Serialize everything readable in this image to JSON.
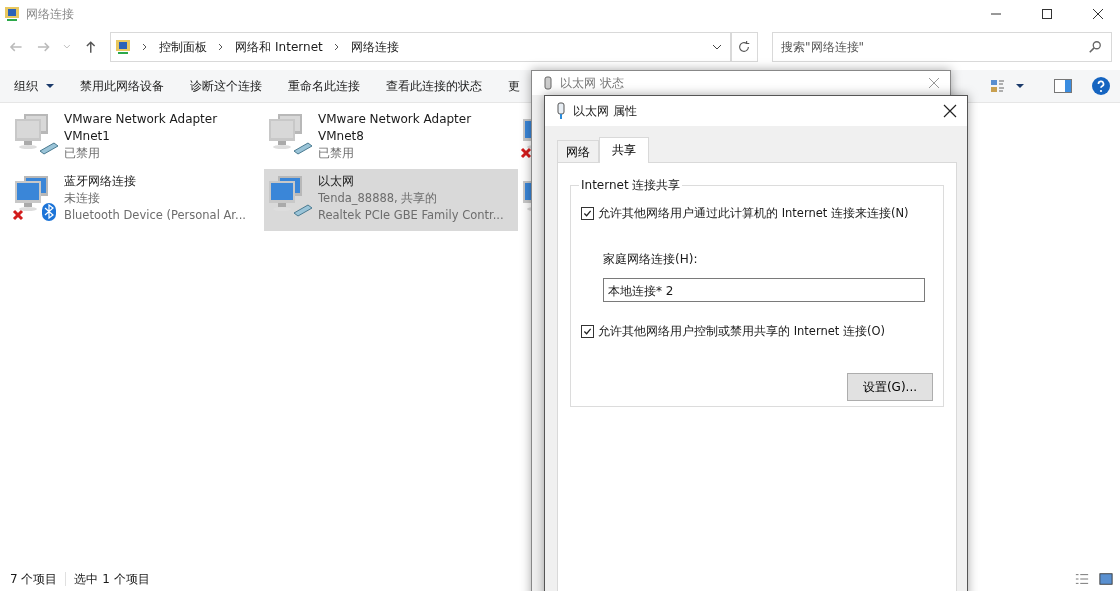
{
  "window": {
    "title": "网络连接"
  },
  "address": {
    "path": [
      "控制面板",
      "网络和 Internet",
      "网络连接"
    ],
    "search_placeholder": "搜索\"网络连接\""
  },
  "toolbar": [
    {
      "label": "组织",
      "kind": "menu"
    },
    {
      "label": "禁用此网络设备",
      "kind": "button"
    },
    {
      "label": "诊断这个连接",
      "kind": "button"
    },
    {
      "label": "重命名此连接",
      "kind": "button"
    },
    {
      "label": "查看此连接的状态",
      "kind": "button"
    },
    {
      "label": "更",
      "kind": "button"
    }
  ],
  "connections": [
    {
      "name": "VMware Network Adapter VMnet1",
      "status": "已禁用",
      "kind": "disabled",
      "bluetooth": false,
      "selected": false
    },
    {
      "name": "VMware Network Adapter VMnet8",
      "status": "已禁用",
      "kind": "disabled",
      "bluetooth": false,
      "selected": false
    },
    {
      "kind": "disconnected"
    },
    {
      "name": "蓝牙网络连接",
      "status": "未连接",
      "device": "Bluetooth Device (Personal Ar...",
      "kind": "disconnected",
      "bluetooth": true,
      "selected": false
    },
    {
      "name": "以太网",
      "status": "Tenda_88888, 共享的",
      "device": "Realtek PCIe GBE Family Contr...",
      "kind": "connected",
      "bluetooth": false,
      "selected": true
    },
    {
      "kind": "connected"
    }
  ],
  "status_bar": {
    "count": "7 个项目",
    "selection": "选中 1 个项目"
  },
  "status_dialog": {
    "title": "以太网 状态"
  },
  "properties_dialog": {
    "title": "以太网 属性",
    "tabs": [
      {
        "label": "网络",
        "selected": false
      },
      {
        "label": "共享",
        "selected": true
      }
    ],
    "group_title": "Internet 连接共享",
    "allow_sharing": {
      "label": "允许其他网络用户通过此计算机的 Internet 连接来连接(N)",
      "checked": true
    },
    "home_label": "家庭网络连接(H):",
    "home_value": "本地连接* 2",
    "allow_control": {
      "label": "允许其他网络用户控制或禁用共享的 Internet 连接(O)",
      "checked": true
    },
    "settings_button": "设置(G)..."
  }
}
